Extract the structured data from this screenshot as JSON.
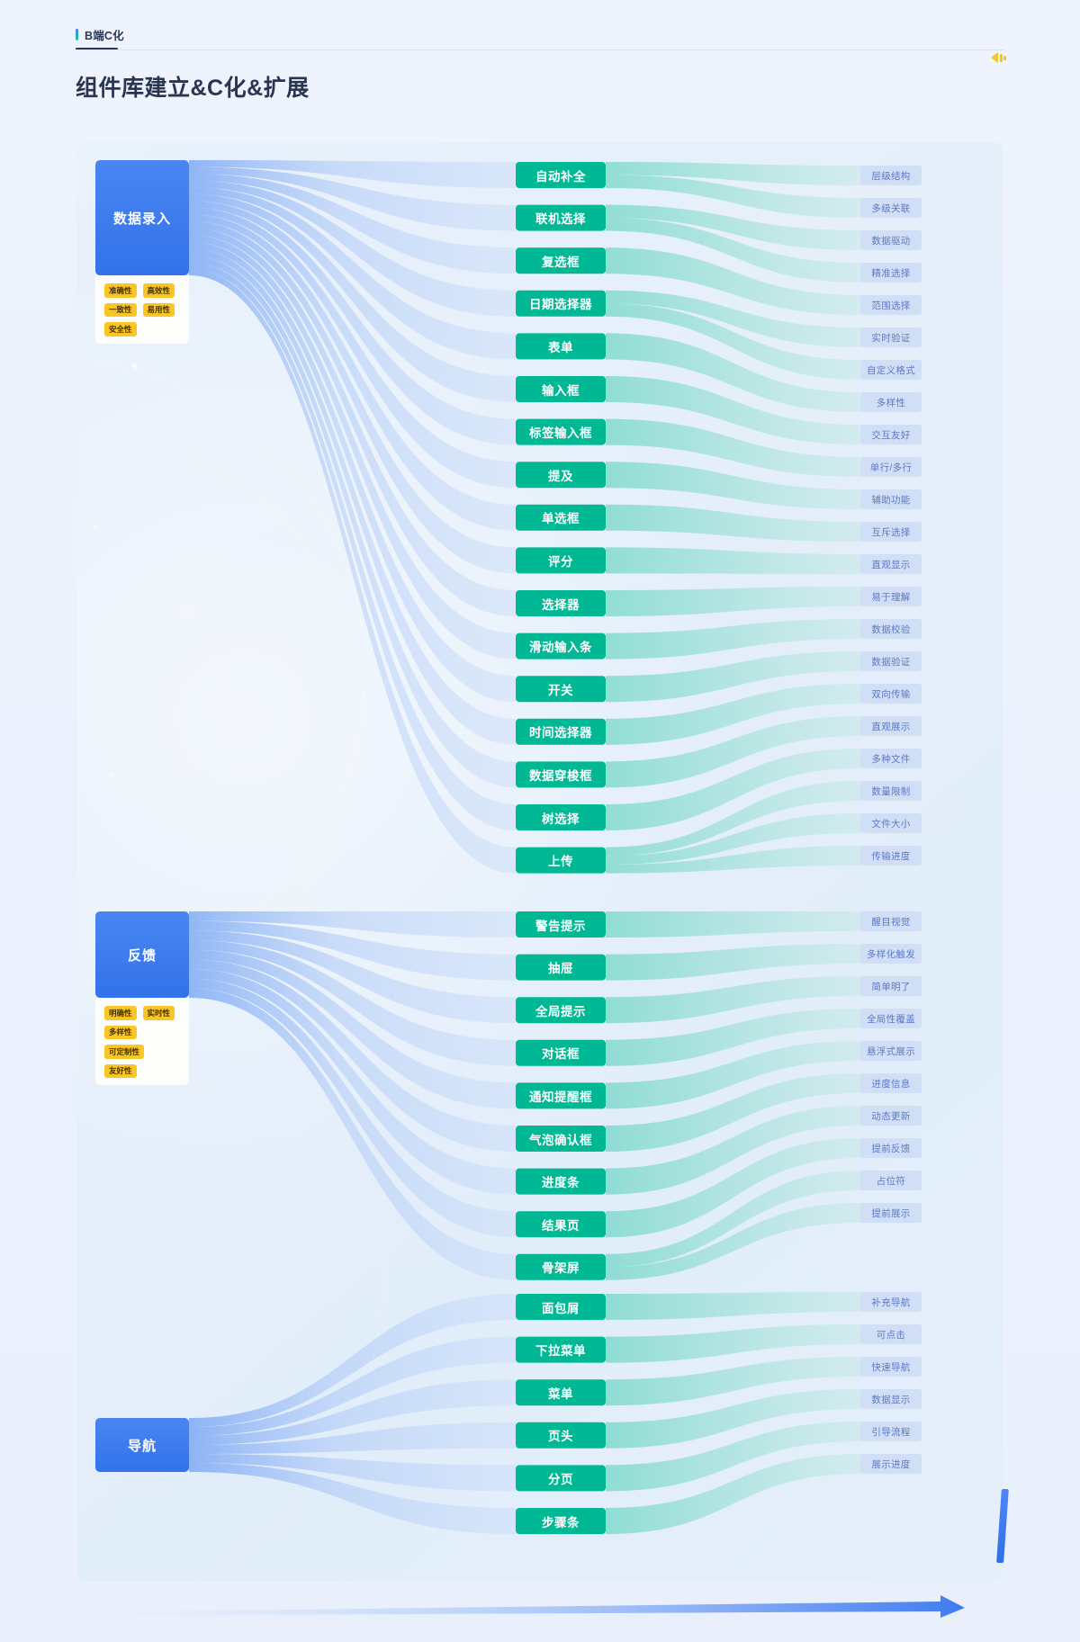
{
  "header": {
    "breadcrumb": "B端C化",
    "title": "组件库建立&C化&扩展",
    "sound_icon": "volume-icon"
  },
  "chart_data": {
    "type": "sankey",
    "title": "组件库建立&C化&扩展",
    "legend_position": "none",
    "grid": false,
    "nodes": {
      "sources": [
        {
          "name": "数据录入",
          "value": 17,
          "tags": [
            "准确性",
            "高效性",
            "一致性",
            "易用性",
            "安全性"
          ]
        },
        {
          "name": "反馈",
          "value": 9,
          "tags": [
            "明确性",
            "实时性",
            "多样性",
            "可定制性",
            "友好性"
          ]
        },
        {
          "name": "导航",
          "value": 6,
          "tags": []
        }
      ],
      "middle": [
        "自动补全",
        "联机选择",
        "复选框",
        "日期选择器",
        "表单",
        "输入框",
        "标签输入框",
        "提及",
        "单选框",
        "评分",
        "选择器",
        "滑动输入条",
        "开关",
        "时间选择器",
        "数据穿梭框",
        "树选择",
        "上传",
        "警告提示",
        "抽屉",
        "全局提示",
        "对话框",
        "通知提醒框",
        "气泡确认框",
        "进度条",
        "结果页",
        "骨架屏",
        "面包屑",
        "下拉菜单",
        "菜单",
        "页头",
        "分页",
        "步骤条"
      ],
      "targets": [
        "层级结构",
        "多级关联",
        "数据驱动",
        "精准选择",
        "范围选择",
        "实时验证",
        "自定义格式",
        "多样性",
        "交互友好",
        "单行/多行",
        "辅助功能",
        "互斥选择",
        "直观显示",
        "易于理解",
        "数据校验",
        "数据验证",
        "双向传输",
        "直观展示",
        "多种文件",
        "数量限制",
        "文件大小",
        "传输进度",
        "醒目视觉",
        "多样化触发",
        "简单明了",
        "全局性覆盖",
        "悬浮式展示",
        "进度信息",
        "动态更新",
        "提前反馈",
        "占位符",
        "提前展示",
        "补充导航",
        "可点击",
        "快速导航",
        "数据显示",
        "引导流程",
        "展示进度"
      ]
    },
    "links_source_to_middle": [
      {
        "source": "数据录入",
        "target": "自动补全",
        "value": 1
      },
      {
        "source": "数据录入",
        "target": "联机选择",
        "value": 1
      },
      {
        "source": "数据录入",
        "target": "复选框",
        "value": 1
      },
      {
        "source": "数据录入",
        "target": "日期选择器",
        "value": 1
      },
      {
        "source": "数据录入",
        "target": "表单",
        "value": 1
      },
      {
        "source": "数据录入",
        "target": "输入框",
        "value": 1
      },
      {
        "source": "数据录入",
        "target": "标签输入框",
        "value": 1
      },
      {
        "source": "数据录入",
        "target": "提及",
        "value": 1
      },
      {
        "source": "数据录入",
        "target": "单选框",
        "value": 1
      },
      {
        "source": "数据录入",
        "target": "评分",
        "value": 1
      },
      {
        "source": "数据录入",
        "target": "选择器",
        "value": 1
      },
      {
        "source": "数据录入",
        "target": "滑动输入条",
        "value": 1
      },
      {
        "source": "数据录入",
        "target": "开关",
        "value": 1
      },
      {
        "source": "数据录入",
        "target": "时间选择器",
        "value": 1
      },
      {
        "source": "数据录入",
        "target": "数据穿梭框",
        "value": 1
      },
      {
        "source": "数据录入",
        "target": "树选择",
        "value": 1
      },
      {
        "source": "数据录入",
        "target": "上传",
        "value": 1
      },
      {
        "source": "反馈",
        "target": "警告提示",
        "value": 1
      },
      {
        "source": "反馈",
        "target": "抽屉",
        "value": 1
      },
      {
        "source": "反馈",
        "target": "全局提示",
        "value": 1
      },
      {
        "source": "反馈",
        "target": "对话框",
        "value": 1
      },
      {
        "source": "反馈",
        "target": "通知提醒框",
        "value": 1
      },
      {
        "source": "反馈",
        "target": "气泡确认框",
        "value": 1
      },
      {
        "source": "反馈",
        "target": "进度条",
        "value": 1
      },
      {
        "source": "反馈",
        "target": "结果页",
        "value": 1
      },
      {
        "source": "反馈",
        "target": "骨架屏",
        "value": 1
      },
      {
        "source": "导航",
        "target": "面包屑",
        "value": 1
      },
      {
        "source": "导航",
        "target": "下拉菜单",
        "value": 1
      },
      {
        "source": "导航",
        "target": "菜单",
        "value": 1
      },
      {
        "source": "导航",
        "target": "页头",
        "value": 1
      },
      {
        "source": "导航",
        "target": "分页",
        "value": 1
      },
      {
        "source": "导航",
        "target": "步骤条",
        "value": 1
      }
    ],
    "links_middle_to_target": [
      {
        "source": "自动补全",
        "target": "层级结构",
        "value": 1
      },
      {
        "source": "自动补全",
        "target": "多级关联",
        "value": 1
      },
      {
        "source": "联机选择",
        "target": "数据驱动",
        "value": 1
      },
      {
        "source": "联机选择",
        "target": "精准选择",
        "value": 1
      },
      {
        "source": "复选框",
        "target": "范围选择",
        "value": 1
      },
      {
        "source": "日期选择器",
        "target": "实时验证",
        "value": 1
      },
      {
        "source": "日期选择器",
        "target": "自定义格式",
        "value": 1
      },
      {
        "source": "表单",
        "target": "多样性",
        "value": 1
      },
      {
        "source": "输入框",
        "target": "交互友好",
        "value": 1
      },
      {
        "source": "标签输入框",
        "target": "单行/多行",
        "value": 1
      },
      {
        "source": "提及",
        "target": "辅助功能",
        "value": 1
      },
      {
        "source": "单选框",
        "target": "互斥选择",
        "value": 1
      },
      {
        "source": "评分",
        "target": "直观显示",
        "value": 1
      },
      {
        "source": "选择器",
        "target": "易于理解",
        "value": 1
      },
      {
        "source": "滑动输入条",
        "target": "数据校验",
        "value": 1
      },
      {
        "source": "开关",
        "target": "数据验证",
        "value": 1
      },
      {
        "source": "时间选择器",
        "target": "双向传输",
        "value": 1
      },
      {
        "source": "数据穿梭框",
        "target": "直观展示",
        "value": 1
      },
      {
        "source": "树选择",
        "target": "多种文件",
        "value": 1
      },
      {
        "source": "上传",
        "target": "数量限制",
        "value": 1
      },
      {
        "source": "上传",
        "target": "文件大小",
        "value": 1
      },
      {
        "source": "上传",
        "target": "传输进度",
        "value": 1
      },
      {
        "source": "警告提示",
        "target": "醒目视觉",
        "value": 1
      },
      {
        "source": "抽屉",
        "target": "多样化触发",
        "value": 1
      },
      {
        "source": "全局提示",
        "target": "简单明了",
        "value": 1
      },
      {
        "source": "对话框",
        "target": "全局性覆盖",
        "value": 1
      },
      {
        "source": "通知提醒框",
        "target": "悬浮式展示",
        "value": 1
      },
      {
        "source": "气泡确认框",
        "target": "进度信息",
        "value": 1
      },
      {
        "source": "进度条",
        "target": "动态更新",
        "value": 1
      },
      {
        "source": "结果页",
        "target": "提前反馈",
        "value": 1
      },
      {
        "source": "骨架屏",
        "target": "占位符",
        "value": 1
      },
      {
        "source": "骨架屏",
        "target": "提前展示",
        "value": 1
      },
      {
        "source": "面包屑",
        "target": "补充导航",
        "value": 1
      },
      {
        "source": "下拉菜单",
        "target": "可点击",
        "value": 1
      },
      {
        "source": "菜单",
        "target": "快速导航",
        "value": 1
      },
      {
        "source": "页头",
        "target": "数据显示",
        "value": 1
      },
      {
        "source": "分页",
        "target": "引导流程",
        "value": 1
      },
      {
        "source": "步骤条",
        "target": "展示进度",
        "value": 1
      }
    ],
    "colors": {
      "source_node": "#3d7ef0",
      "middle_node": "#00b894",
      "target_node": "#cddcf5",
      "link_blue": "#a9c6f5",
      "link_green": "#8fdcc8",
      "tag": "#f9c625",
      "background": "#eef4fd"
    }
  }
}
